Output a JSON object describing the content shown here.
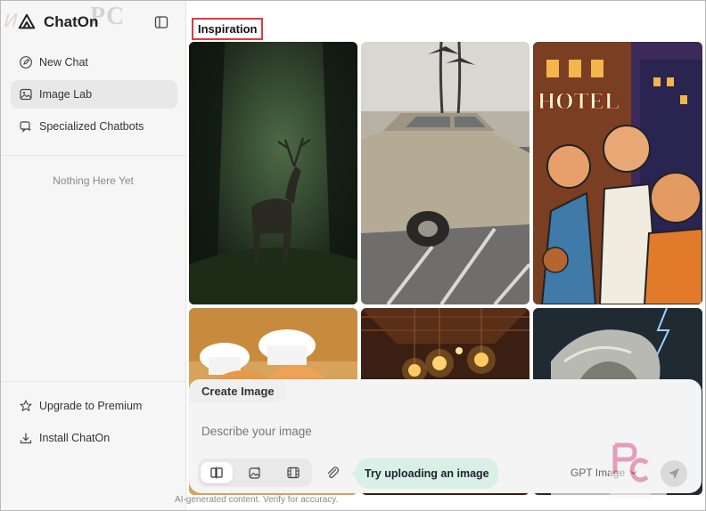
{
  "brand": {
    "name": "ChatOn",
    "watermark": "PC"
  },
  "sidebar": {
    "items": [
      {
        "label": "New Chat",
        "icon": "new-chat-icon",
        "active": false
      },
      {
        "label": "Image Lab",
        "icon": "image-icon",
        "active": true
      },
      {
        "label": "Specialized Chatbots",
        "icon": "chatbot-icon",
        "active": false
      }
    ],
    "empty_text": "Nothing Here Yet",
    "bottom_items": [
      {
        "label": "Upgrade to Premium",
        "icon": "star-icon"
      },
      {
        "label": "Install ChatOn",
        "icon": "download-icon"
      }
    ]
  },
  "main": {
    "section_title": "Inspiration",
    "tiles": [
      {
        "name": "tile-forest-deer"
      },
      {
        "name": "tile-vintage-car"
      },
      {
        "name": "tile-hotel-cartoon"
      },
      {
        "name": "tile-chef-cat"
      },
      {
        "name": "tile-lantern-room"
      },
      {
        "name": "tile-stormy-portrait"
      }
    ]
  },
  "composer": {
    "tab_label": "Create Image",
    "placeholder": "Describe your image",
    "tooltip": "Try uploading an image",
    "model": "GPT Image",
    "disclaimer": "AI-generated content. Verify for accuracy."
  },
  "colors": {
    "accent_highlight": "#e03b3b",
    "tooltip_bg": "#d8f0e6",
    "active_item": "#e8e8e8"
  }
}
